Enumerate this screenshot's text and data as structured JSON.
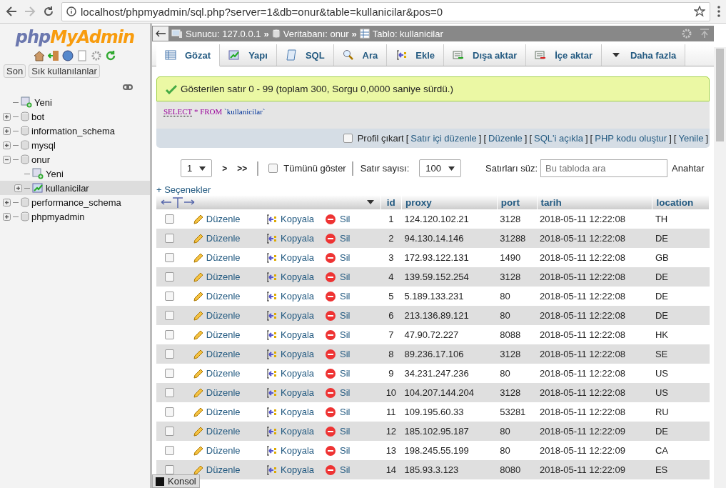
{
  "browser": {
    "url": "localhost/phpmyadmin/sql.php?server=1&db=onur&table=kullanicilar&pos=0"
  },
  "sidebar": {
    "logo_left": "php",
    "logo_right": "MyAdmin",
    "buttons": [
      "Son",
      "Sık kullanılanlar"
    ],
    "tree": [
      {
        "label": "Yeni",
        "kind": "new",
        "selected": false
      },
      {
        "label": "bot",
        "kind": "db",
        "expanded": false,
        "selected": false
      },
      {
        "label": "information_schema",
        "kind": "db",
        "expanded": false,
        "selected": false
      },
      {
        "label": "mysql",
        "kind": "db",
        "expanded": false,
        "selected": false
      },
      {
        "label": "onur",
        "kind": "db",
        "expanded": true,
        "selected": false,
        "children": [
          {
            "label": "Yeni",
            "kind": "new-table",
            "selected": false
          },
          {
            "label": "kullanicilar",
            "kind": "table",
            "expanded": false,
            "selected": true
          }
        ]
      },
      {
        "label": "performance_schema",
        "kind": "db",
        "expanded": false,
        "selected": false
      },
      {
        "label": "phpmyadmin",
        "kind": "db",
        "expanded": false,
        "selected": false
      }
    ]
  },
  "breadcrumb": [
    {
      "label": "Sunucu: 127.0.0.1",
      "kind": "server",
      "separator": "»"
    },
    {
      "label": "Veritabanı: onur",
      "kind": "db",
      "separator": "»"
    },
    {
      "label": "Tablo: kullanicilar",
      "kind": "table"
    }
  ],
  "tabs": [
    {
      "label": "Gözat",
      "kind": "browse",
      "selected": true
    },
    {
      "label": "Yapı",
      "kind": "structure",
      "selected": false
    },
    {
      "label": "SQL",
      "kind": "sql",
      "selected": false
    },
    {
      "label": "Ara",
      "kind": "search",
      "selected": false
    },
    {
      "label": "Ekle",
      "kind": "insert",
      "selected": false
    },
    {
      "label": "Dışa aktar",
      "kind": "export",
      "selected": false
    },
    {
      "label": "İçe aktar",
      "kind": "import",
      "selected": false
    },
    {
      "label": "Daha fazla",
      "kind": "more",
      "selected": false
    }
  ],
  "message": "Gösterilen satır 0 - 99 (toplam 300, Sorgu 0,0000 saniye sürdü.)",
  "query": {
    "keyword1": "SELECT",
    "rest": "* FROM",
    "table": "`kullanicilar`"
  },
  "query_tools": {
    "profile_label": "Profil çıkart",
    "profile_checked": false,
    "links": [
      {
        "before": "[",
        "label": "Satır içi düzenle",
        "after": "]"
      },
      {
        "before": "[",
        "label": "Düzenle",
        "after": "]"
      },
      {
        "before": "[",
        "label": "SQL'i açıkla",
        "after": "]"
      },
      {
        "before": "[",
        "label": "PHP kodu oluştur",
        "after": "]"
      },
      {
        "before": "[",
        "label": "Yenile",
        "after": "]"
      }
    ]
  },
  "pagination": {
    "page": "1",
    "next": ">",
    "last": ">>",
    "show_all": "Tümünü göster",
    "show_all_checked": false,
    "rows_label": "Satır sayısı:",
    "rows_value": "100",
    "filter_label": "Satırları süz:",
    "filter_placeholder": "Bu tabloda ara",
    "key_label": "Anahtar"
  },
  "options_link": "+ Seçenekler",
  "table": {
    "columns": [
      "id",
      "proxy",
      "port",
      "tarih",
      "location"
    ],
    "rows": [
      {
        "checked": false,
        "actions": [
          "Düzenle",
          "Kopyala",
          "Sil"
        ],
        "cells": [
          "1",
          "124.120.102.21",
          "3128",
          "2018-05-11 12:22:08",
          "TH"
        ]
      },
      {
        "checked": false,
        "actions": [
          "Düzenle",
          "Kopyala",
          "Sil"
        ],
        "cells": [
          "2",
          "94.130.14.146",
          "31288",
          "2018-05-11 12:22:08",
          "DE"
        ]
      },
      {
        "checked": false,
        "actions": [
          "Düzenle",
          "Kopyala",
          "Sil"
        ],
        "cells": [
          "3",
          "172.93.122.131",
          "1490",
          "2018-05-11 12:22:08",
          "GB"
        ]
      },
      {
        "checked": false,
        "actions": [
          "Düzenle",
          "Kopyala",
          "Sil"
        ],
        "cells": [
          "4",
          "139.59.152.254",
          "3128",
          "2018-05-11 12:22:08",
          "DE"
        ]
      },
      {
        "checked": false,
        "actions": [
          "Düzenle",
          "Kopyala",
          "Sil"
        ],
        "cells": [
          "5",
          "5.189.133.231",
          "80",
          "2018-05-11 12:22:08",
          "DE"
        ]
      },
      {
        "checked": false,
        "actions": [
          "Düzenle",
          "Kopyala",
          "Sil"
        ],
        "cells": [
          "6",
          "213.136.89.121",
          "80",
          "2018-05-11 12:22:08",
          "DE"
        ]
      },
      {
        "checked": false,
        "actions": [
          "Düzenle",
          "Kopyala",
          "Sil"
        ],
        "cells": [
          "7",
          "47.90.72.227",
          "8088",
          "2018-05-11 12:22:08",
          "HK"
        ]
      },
      {
        "checked": false,
        "actions": [
          "Düzenle",
          "Kopyala",
          "Sil"
        ],
        "cells": [
          "8",
          "89.236.17.106",
          "3128",
          "2018-05-11 12:22:08",
          "SE"
        ]
      },
      {
        "checked": false,
        "actions": [
          "Düzenle",
          "Kopyala",
          "Sil"
        ],
        "cells": [
          "9",
          "34.231.247.236",
          "80",
          "2018-05-11 12:22:08",
          "US"
        ]
      },
      {
        "checked": false,
        "actions": [
          "Düzenle",
          "Kopyala",
          "Sil"
        ],
        "cells": [
          "10",
          "104.207.144.204",
          "3128",
          "2018-05-11 12:22:08",
          "US"
        ]
      },
      {
        "checked": false,
        "actions": [
          "Düzenle",
          "Kopyala",
          "Sil"
        ],
        "cells": [
          "11",
          "109.195.60.33",
          "53281",
          "2018-05-11 12:22:08",
          "RU"
        ]
      },
      {
        "checked": false,
        "actions": [
          "Düzenle",
          "Kopyala",
          "Sil"
        ],
        "cells": [
          "12",
          "185.102.95.187",
          "80",
          "2018-05-11 12:22:09",
          "DE"
        ]
      },
      {
        "checked": false,
        "actions": [
          "Düzenle",
          "Kopyala",
          "Sil"
        ],
        "cells": [
          "13",
          "198.245.55.199",
          "80",
          "2018-05-11 12:22:09",
          "CA"
        ]
      },
      {
        "checked": false,
        "actions": [
          "Düzenle",
          "Kopyala",
          "Sil"
        ],
        "cells": [
          "14",
          "185.93.3.123",
          "8080",
          "2018-05-11 12:22:09",
          "ES"
        ]
      }
    ]
  },
  "console": "Konsol"
}
